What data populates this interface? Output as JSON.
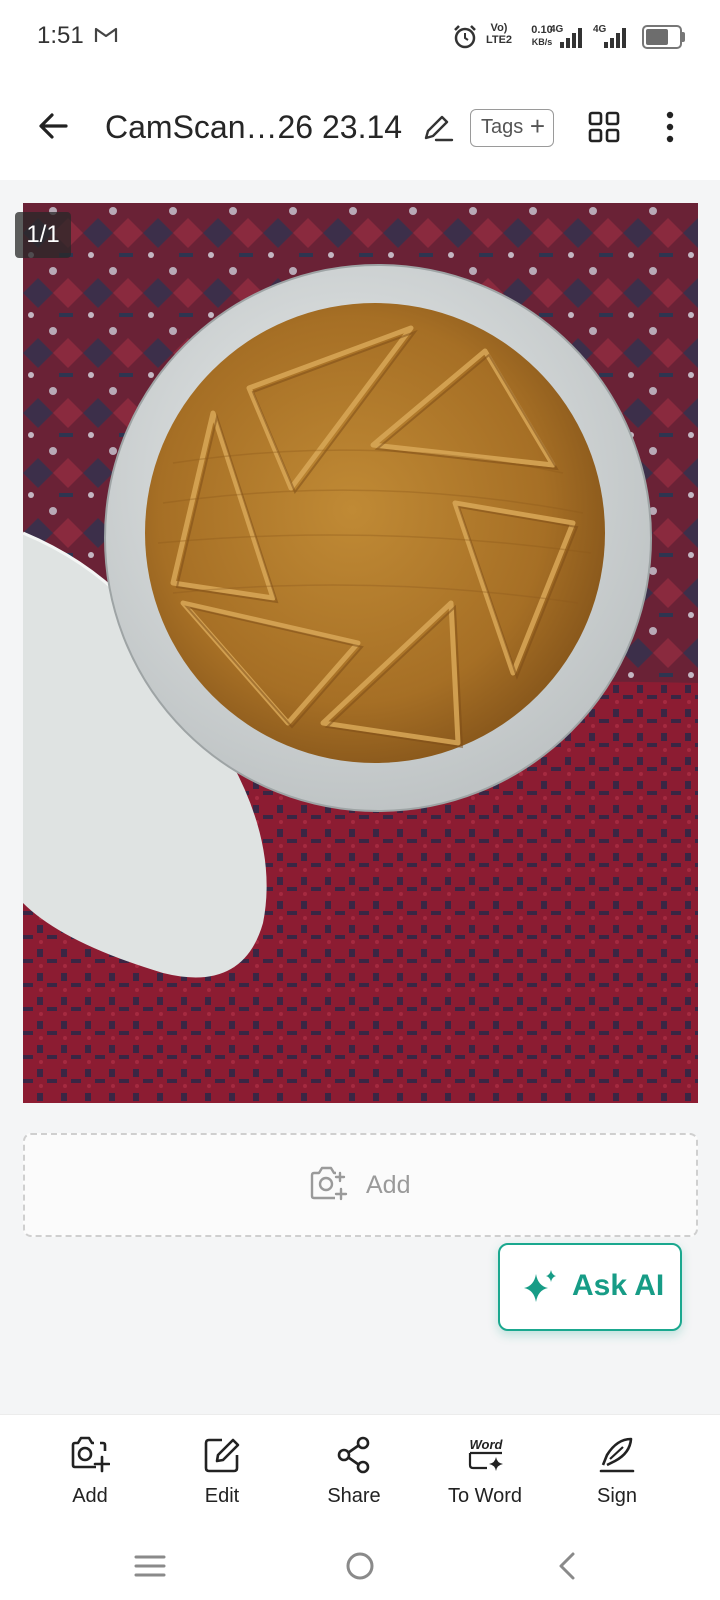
{
  "status_bar": {
    "time": "1:51",
    "volte_line1": "Vo)",
    "volte_line2": "LTE2",
    "speed_value": "0.10",
    "speed_unit": "KB/s",
    "network_1": "4G",
    "network_2": "4G",
    "battery_level": 0.7
  },
  "header": {
    "title": "CamScan…26 23.14",
    "tags_label": "Tags"
  },
  "page": {
    "counter": "1/1"
  },
  "add_area": {
    "label": "Add"
  },
  "ask_ai": {
    "label": "Ask AI"
  },
  "toolbar": {
    "items": [
      {
        "label": "Add",
        "icon": "camera-plus-icon"
      },
      {
        "label": "Edit",
        "icon": "edit-icon"
      },
      {
        "label": "Share",
        "icon": "share-icon"
      },
      {
        "label": "To Word",
        "icon": "word-icon",
        "icon_text": "Word"
      },
      {
        "label": "Sign",
        "icon": "signature-icon"
      }
    ]
  },
  "colors": {
    "accent": "#179c86",
    "background": "#f4f5f6"
  }
}
